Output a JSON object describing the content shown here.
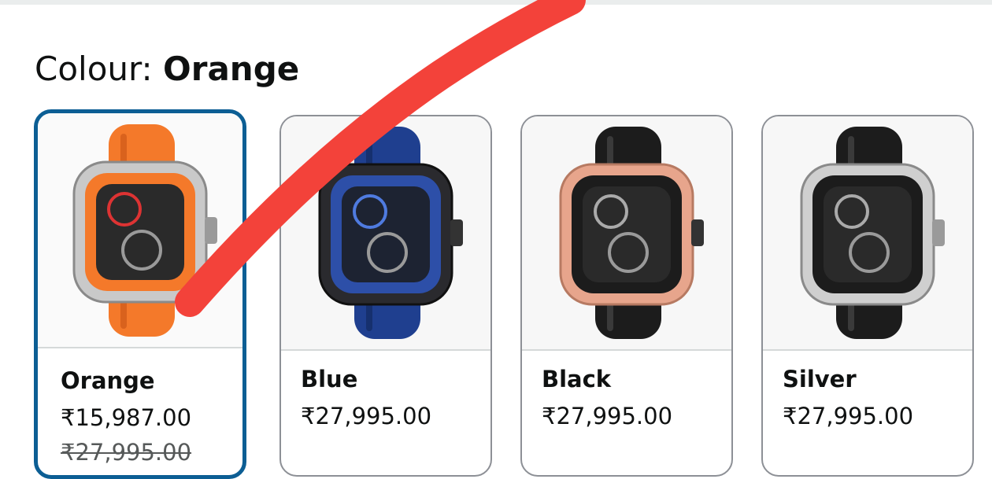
{
  "colour": {
    "label": "Colour: ",
    "selected": "Orange"
  },
  "swatches": [
    {
      "name": "Orange",
      "price": "₹15,987.00",
      "old_price": "₹27,995.00",
      "strap_color": "#f4792a",
      "case_color": "#c9c9c9",
      "bezel_color": "#f4792a"
    },
    {
      "name": "Blue",
      "price": "₹27,995.00",
      "strap_color": "#1f3f8f",
      "case_color": "#2a2a2e",
      "bezel_color": "#2d4fa8"
    },
    {
      "name": "Black",
      "price": "₹27,995.00",
      "strap_color": "#1c1c1c",
      "case_color": "#e7a58c",
      "bezel_color": "#1c1c1c"
    },
    {
      "name": "Silver",
      "price": "₹27,995.00",
      "strap_color": "#1c1c1c",
      "case_color": "#cfcfcf",
      "bezel_color": "#1c1c1c"
    }
  ],
  "colors": {
    "selected_border": "#0c5e94",
    "annotation_stroke": "#f3423a"
  }
}
